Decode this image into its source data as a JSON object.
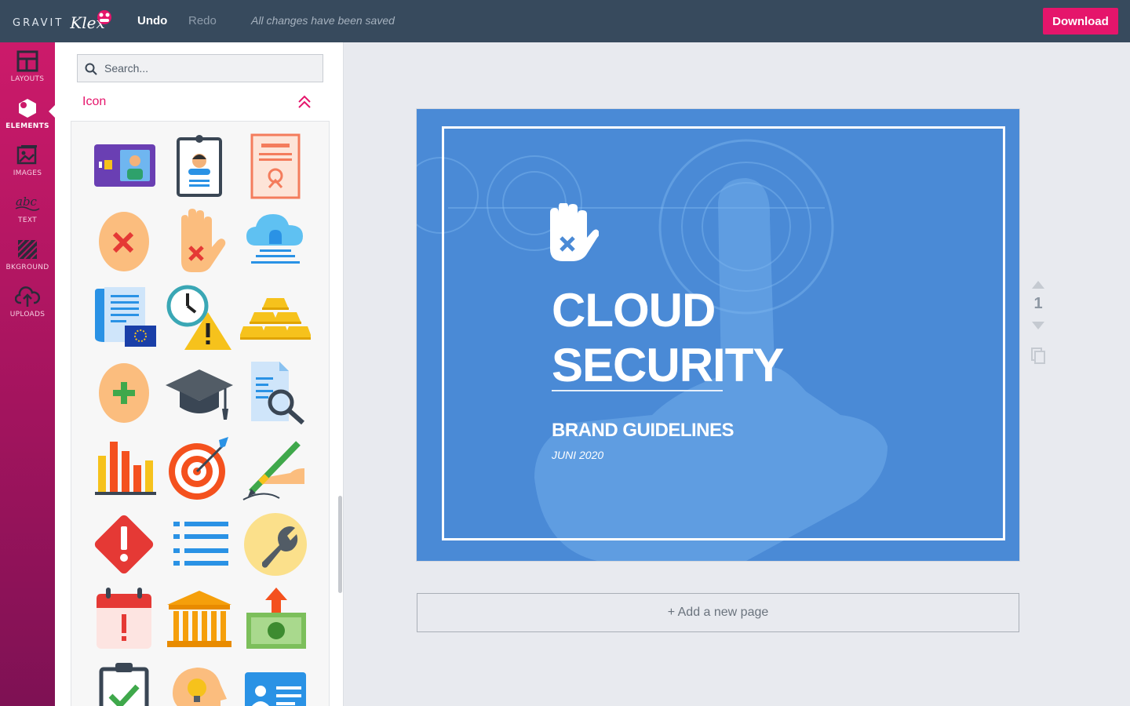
{
  "header": {
    "brand_gravit": "GRAVIT",
    "brand_klex": "Klex",
    "undo_label": "Undo",
    "redo_label": "Redo",
    "save_status": "All changes have been saved",
    "download_label": "Download"
  },
  "sidebar": {
    "items": [
      {
        "label": "LAYOUTS",
        "icon": "layouts-icon",
        "active": false
      },
      {
        "label": "ELEMENTS",
        "icon": "elements-icon",
        "active": true
      },
      {
        "label": "IMAGES",
        "icon": "images-icon",
        "active": false
      },
      {
        "label": "TEXT",
        "icon": "text-icon",
        "active": false
      },
      {
        "label": "BKGROUND",
        "icon": "background-icon",
        "active": false
      },
      {
        "label": "UPLOADS",
        "icon": "uploads-icon",
        "active": false
      }
    ]
  },
  "panel": {
    "search_placeholder": "Search...",
    "section_title": "Icon",
    "icons": [
      "id-card-icon",
      "id-badge-icon",
      "certificate-icon",
      "head-reject-icon",
      "hand-stop-icon",
      "cloud-server-icon",
      "eu-document-icon",
      "clock-warning-icon",
      "gold-bars-icon",
      "head-add-icon",
      "graduation-cap-icon",
      "document-search-icon",
      "bar-chart-icon",
      "target-icon",
      "signing-pen-icon",
      "alert-diamond-icon",
      "list-icon",
      "wrench-icon",
      "calendar-alert-icon",
      "bank-icon",
      "money-up-icon",
      "clipboard-check-icon",
      "idea-head-icon",
      "contact-card-icon"
    ]
  },
  "canvas": {
    "title_line1": "CLOUD",
    "title_line2": "SECURITY",
    "subtitle": "BRAND GUIDELINES",
    "date": "JUNI 2020",
    "logo_icon": "hand-stop-icon",
    "page_number": "1",
    "add_page_label": "+ Add a new page"
  },
  "colors": {
    "topbar": "#374a5d",
    "accent": "#e5156b",
    "page_background": "#4a8ad6",
    "workspace": "#e8eaef"
  }
}
